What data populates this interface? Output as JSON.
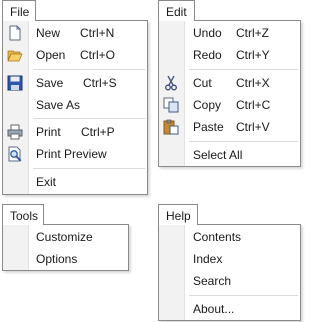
{
  "file": {
    "title": "File",
    "items": [
      {
        "label": "New",
        "shortcut": "Ctrl+N",
        "icon": "new-document-icon"
      },
      {
        "label": "Open",
        "shortcut": "Ctrl+O",
        "icon": "open-folder-icon"
      },
      {
        "label": "Save",
        "shortcut": "Ctrl+S",
        "icon": "save-disk-icon"
      },
      {
        "label": "Save As",
        "shortcut": ""
      },
      {
        "label": "Print",
        "shortcut": "Ctrl+P",
        "icon": "printer-icon"
      },
      {
        "label": "Print Preview",
        "shortcut": "",
        "icon": "print-preview-icon"
      },
      {
        "label": "Exit",
        "shortcut": ""
      }
    ]
  },
  "edit": {
    "title": "Edit",
    "items": [
      {
        "label": "Undo",
        "shortcut": "Ctrl+Z"
      },
      {
        "label": "Redo",
        "shortcut": "Ctrl+Y"
      },
      {
        "label": "Cut",
        "shortcut": "Ctrl+X",
        "icon": "scissors-icon"
      },
      {
        "label": "Copy",
        "shortcut": "Ctrl+C",
        "icon": "copy-icon"
      },
      {
        "label": "Paste",
        "shortcut": "Ctrl+V",
        "icon": "paste-clipboard-icon"
      },
      {
        "label": "Select All",
        "shortcut": ""
      }
    ]
  },
  "tools": {
    "title": "Tools",
    "items": [
      {
        "label": "Customize"
      },
      {
        "label": "Options"
      }
    ]
  },
  "help": {
    "title": "Help",
    "items": [
      {
        "label": "Contents"
      },
      {
        "label": "Index"
      },
      {
        "label": "Search"
      },
      {
        "label": "About..."
      }
    ]
  }
}
